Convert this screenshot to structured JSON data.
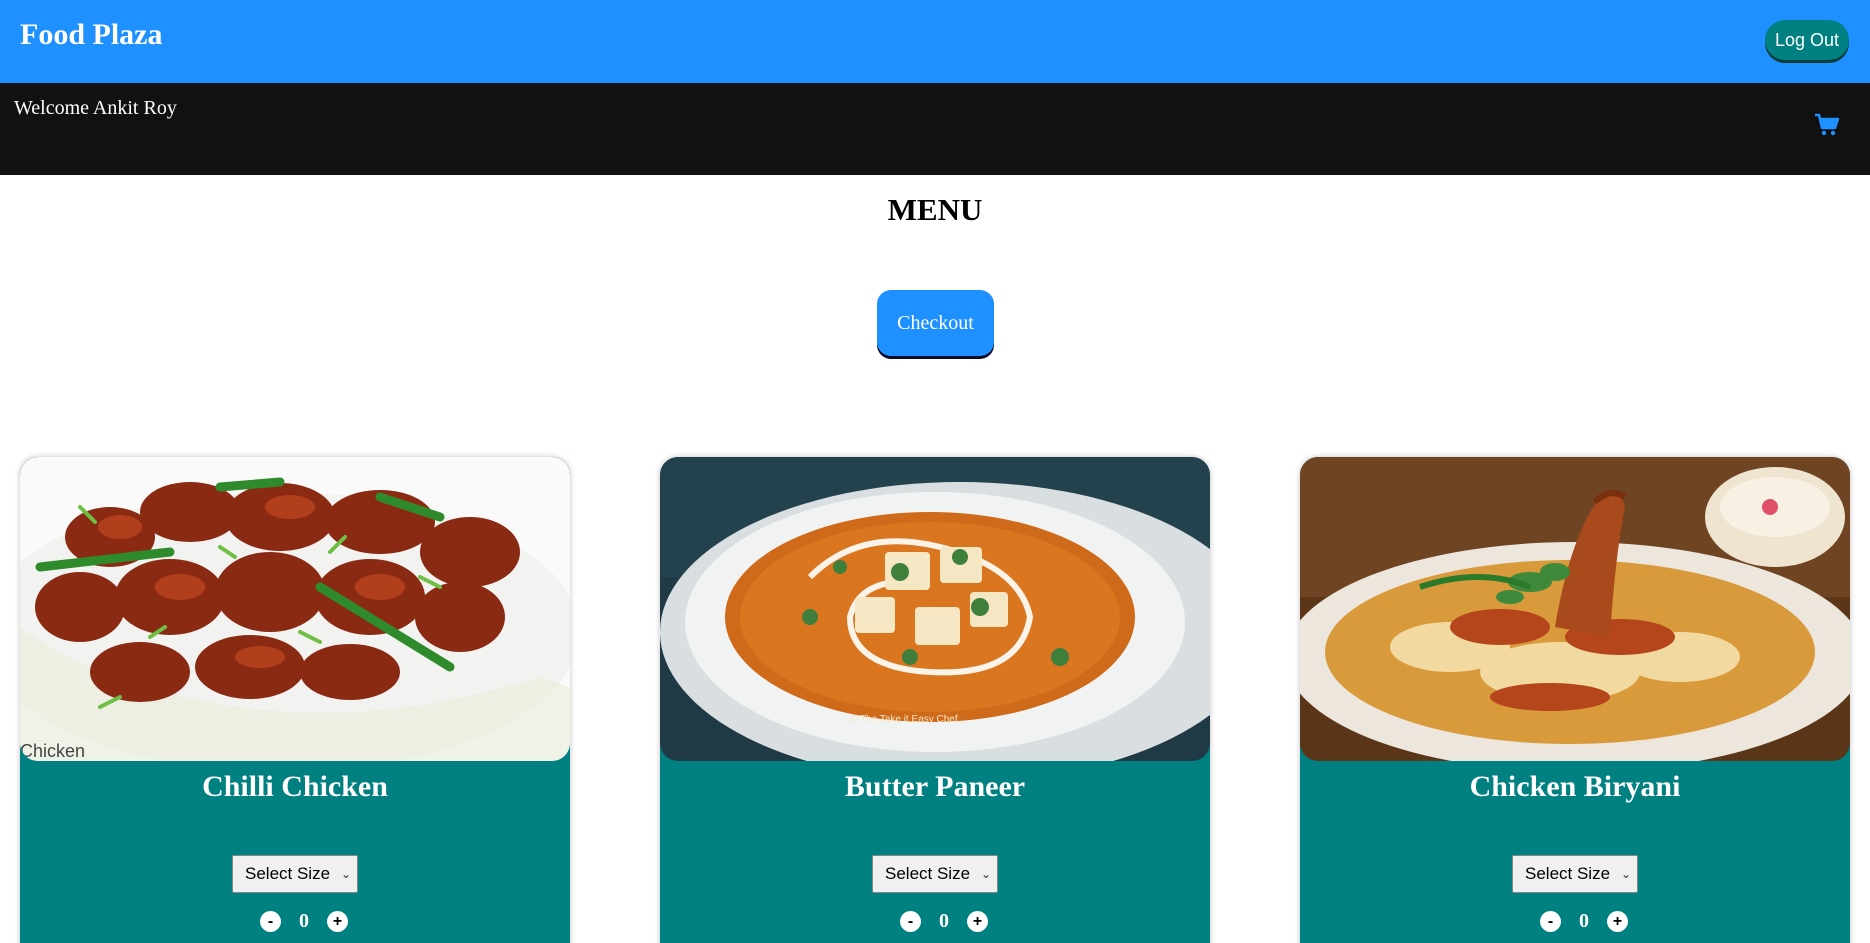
{
  "header": {
    "brand": "Food Plaza",
    "logout_label": "Log Out"
  },
  "welcome": {
    "text": "Welcome Ankit Roy",
    "cart_icon": "shopping-cart-icon"
  },
  "menu": {
    "title": "MENU",
    "checkout_label": "Checkout"
  },
  "items": [
    {
      "name": "Chilli Chicken",
      "size_placeholder": "Select Size",
      "quantity": "0",
      "minus": "-",
      "plus": "+",
      "image_caption": "Chicken"
    },
    {
      "name": "Butter Paneer",
      "size_placeholder": "Select Size",
      "quantity": "0",
      "minus": "-",
      "plus": "+",
      "image_caption": "© The Take it Easy Chef"
    },
    {
      "name": "Chicken Biryani",
      "size_placeholder": "Select Size",
      "quantity": "0",
      "minus": "-",
      "plus": "+"
    }
  ],
  "colors": {
    "header_bg": "#1e90ff",
    "welcome_bg": "#111111",
    "card_bg": "#008080",
    "logout_bg": "#008080",
    "add_button": "#c0282d"
  }
}
